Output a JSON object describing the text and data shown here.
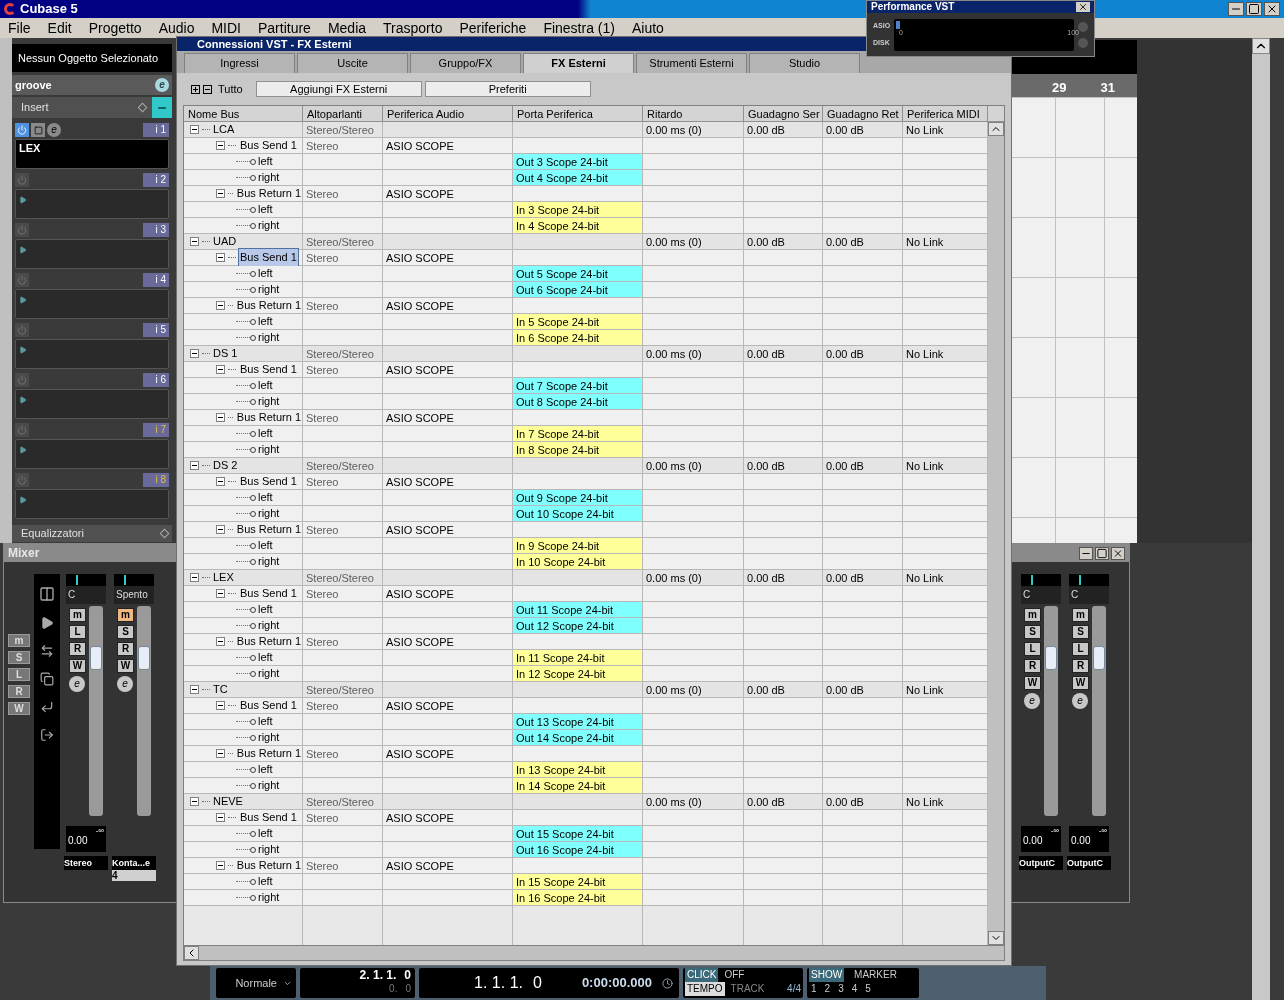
{
  "app_window": {
    "title": "Cubase 5"
  },
  "menu": [
    {
      "label": "File"
    },
    {
      "label": "Edit"
    },
    {
      "label": "Progetto"
    },
    {
      "label": "Audio"
    },
    {
      "label": "MIDI"
    },
    {
      "label": "Partiture"
    },
    {
      "label": "Media"
    },
    {
      "label": "Trasporto"
    },
    {
      "label": "Periferiche"
    },
    {
      "label": "Finestra (1)"
    },
    {
      "label": "Aiuto"
    }
  ],
  "inspector": {
    "selection": "Nessun Oggetto Selezionato",
    "track": "groove",
    "edit_button": "e",
    "insert_section": "Insert",
    "inserts": [
      {
        "slot": "i 1",
        "name": "LEX",
        "on": true,
        "post_fader": false,
        "edit": "e"
      },
      {
        "slot": "i 2",
        "on": false,
        "post_fader": false
      },
      {
        "slot": "i 3",
        "on": false,
        "post_fader": false
      },
      {
        "slot": "i 4",
        "on": false,
        "post_fader": false
      },
      {
        "slot": "i 5",
        "on": false,
        "post_fader": false
      },
      {
        "slot": "i 6",
        "on": false,
        "post_fader": false
      },
      {
        "slot": "i 7",
        "on": false,
        "post_fader": true
      },
      {
        "slot": "i 8",
        "on": false,
        "post_fader": true
      }
    ],
    "eq_section": "Equalizzatori"
  },
  "project": {
    "ruler": [
      "29",
      "31"
    ]
  },
  "mixer": {
    "title": "Mixer",
    "global_buttons": [
      "m",
      "S",
      "L",
      "R",
      "W"
    ],
    "left_channels": [
      {
        "name": "Stereo",
        "edit": "e",
        "pan": "C",
        "volume": "0.00",
        "peak": "-∞",
        "buttons": [
          {
            "label": "m",
            "on": false
          },
          {
            "label": "L",
            "on": false
          },
          {
            "label": "R",
            "on": false
          },
          {
            "label": "W",
            "on": false
          }
        ]
      },
      {
        "name": "Konta...e",
        "edit": "e",
        "pan": "Spento",
        "number": "4",
        "buttons": [
          {
            "label": "m",
            "on": true
          },
          {
            "label": "S",
            "on": false
          },
          {
            "label": "R",
            "on": false
          },
          {
            "label": "W",
            "on": false
          }
        ]
      }
    ],
    "right_channels": [
      {
        "name": "OutputC",
        "edit": "e",
        "pan": "C",
        "volume": "0.00",
        "peak": "-∞",
        "buttons": [
          {
            "label": "m",
            "on": false
          },
          {
            "label": "S",
            "on": false
          },
          {
            "label": "L",
            "on": false
          },
          {
            "label": "R",
            "on": false
          },
          {
            "label": "W",
            "on": false
          }
        ]
      },
      {
        "name": "OutputC",
        "edit": "e",
        "pan": "C",
        "volume": "0.00",
        "peak": "-∞",
        "buttons": [
          {
            "label": "m",
            "on": false
          },
          {
            "label": "S",
            "on": false
          },
          {
            "label": "L",
            "on": false
          },
          {
            "label": "R",
            "on": false
          },
          {
            "label": "W",
            "on": false
          }
        ]
      }
    ]
  },
  "dialog": {
    "title": "Connessioni VST - FX Esterni",
    "tabs": [
      {
        "label": "Ingressi",
        "selected": false
      },
      {
        "label": "Uscite",
        "selected": false
      },
      {
        "label": "Gruppo/FX",
        "selected": false
      },
      {
        "label": "FX Esterni",
        "selected": true
      },
      {
        "label": "Strumenti Esterni",
        "selected": false
      },
      {
        "label": "Studio",
        "selected": false
      }
    ],
    "all_label": "Tutto",
    "buttons": [
      "Aggiungi FX Esterni",
      "Preferiti"
    ],
    "columns": [
      "Nome Bus",
      "Altoparlanti",
      "Periferica Audio",
      "Porta Periferica",
      "Ritardo",
      "Guadagno Ser",
      "Guadagno Ret",
      "Periferica MIDI"
    ],
    "buses": [
      {
        "name": "LCA",
        "speakers": "Stereo/Stereo",
        "delay": "0.00 ms (0)",
        "send_gain": "0.00 dB",
        "return_gain": "0.00 dB",
        "midi": "No Link",
        "expanded": true,
        "children": [
          {
            "name": "Bus Send 1",
            "kind": "send",
            "speakers": "Stereo",
            "device": "ASIO SCOPE",
            "expanded": true,
            "selected": false,
            "children": [
              {
                "name": "left",
                "port": "Out 3 Scope 24-bit"
              },
              {
                "name": "right",
                "port": "Out 4 Scope 24-bit"
              }
            ]
          },
          {
            "name": "Bus Return 1",
            "kind": "return",
            "speakers": "Stereo",
            "device": "ASIO SCOPE",
            "expanded": true,
            "selected": false,
            "children": [
              {
                "name": "left",
                "port": "In 3 Scope 24-bit"
              },
              {
                "name": "right",
                "port": "In 4 Scope 24-bit"
              }
            ]
          }
        ]
      },
      {
        "name": "UAD",
        "speakers": "Stereo/Stereo",
        "delay": "0.00 ms (0)",
        "send_gain": "0.00 dB",
        "return_gain": "0.00 dB",
        "midi": "No Link",
        "expanded": true,
        "children": [
          {
            "name": "Bus Send 1",
            "kind": "send",
            "speakers": "Stereo",
            "device": "ASIO SCOPE",
            "expanded": true,
            "selected": true,
            "children": [
              {
                "name": "left",
                "port": "Out 5 Scope 24-bit"
              },
              {
                "name": "right",
                "port": "Out 6 Scope 24-bit"
              }
            ]
          },
          {
            "name": "Bus Return 1",
            "kind": "return",
            "speakers": "Stereo",
            "device": "ASIO SCOPE",
            "expanded": true,
            "selected": false,
            "children": [
              {
                "name": "left",
                "port": "In 5 Scope 24-bit"
              },
              {
                "name": "right",
                "port": "In 6 Scope 24-bit"
              }
            ]
          }
        ]
      },
      {
        "name": "DS 1",
        "speakers": "Stereo/Stereo",
        "delay": "0.00 ms (0)",
        "send_gain": "0.00 dB",
        "return_gain": "0.00 dB",
        "midi": "No Link",
        "expanded": true,
        "children": [
          {
            "name": "Bus Send 1",
            "kind": "send",
            "speakers": "Stereo",
            "device": "ASIO SCOPE",
            "expanded": true,
            "selected": false,
            "children": [
              {
                "name": "left",
                "port": "Out 7 Scope 24-bit"
              },
              {
                "name": "right",
                "port": "Out 8 Scope 24-bit"
              }
            ]
          },
          {
            "name": "Bus Return 1",
            "kind": "return",
            "speakers": "Stereo",
            "device": "ASIO SCOPE",
            "expanded": true,
            "selected": false,
            "children": [
              {
                "name": "left",
                "port": "In 7 Scope 24-bit"
              },
              {
                "name": "right",
                "port": "In 8 Scope 24-bit"
              }
            ]
          }
        ]
      },
      {
        "name": "DS 2",
        "speakers": "Stereo/Stereo",
        "delay": "0.00 ms (0)",
        "send_gain": "0.00 dB",
        "return_gain": "0.00 dB",
        "midi": "No Link",
        "expanded": true,
        "children": [
          {
            "name": "Bus Send 1",
            "kind": "send",
            "speakers": "Stereo",
            "device": "ASIO SCOPE",
            "expanded": true,
            "selected": false,
            "children": [
              {
                "name": "left",
                "port": "Out 9 Scope 24-bit"
              },
              {
                "name": "right",
                "port": "Out 10 Scope 24-bit"
              }
            ]
          },
          {
            "name": "Bus Return 1",
            "kind": "return",
            "speakers": "Stereo",
            "device": "ASIO SCOPE",
            "expanded": true,
            "selected": false,
            "children": [
              {
                "name": "left",
                "port": "In 9 Scope 24-bit"
              },
              {
                "name": "right",
                "port": "In 10 Scope 24-bit"
              }
            ]
          }
        ]
      },
      {
        "name": "LEX",
        "speakers": "Stereo/Stereo",
        "delay": "0.00 ms (0)",
        "send_gain": "0.00 dB",
        "return_gain": "0.00 dB",
        "midi": "No Link",
        "expanded": true,
        "children": [
          {
            "name": "Bus Send 1",
            "kind": "send",
            "speakers": "Stereo",
            "device": "ASIO SCOPE",
            "expanded": true,
            "selected": false,
            "children": [
              {
                "name": "left",
                "port": "Out 11 Scope 24-bit"
              },
              {
                "name": "right",
                "port": "Out 12 Scope 24-bit"
              }
            ]
          },
          {
            "name": "Bus Return 1",
            "kind": "return",
            "speakers": "Stereo",
            "device": "ASIO SCOPE",
            "expanded": true,
            "selected": false,
            "children": [
              {
                "name": "left",
                "port": "In 11 Scope 24-bit"
              },
              {
                "name": "right",
                "port": "In 12 Scope 24-bit"
              }
            ]
          }
        ]
      },
      {
        "name": "TC",
        "speakers": "Stereo/Stereo",
        "delay": "0.00 ms (0)",
        "send_gain": "0.00 dB",
        "return_gain": "0.00 dB",
        "midi": "No Link",
        "expanded": true,
        "children": [
          {
            "name": "Bus Send 1",
            "kind": "send",
            "speakers": "Stereo",
            "device": "ASIO SCOPE",
            "expanded": true,
            "selected": false,
            "children": [
              {
                "name": "left",
                "port": "Out 13 Scope 24-bit"
              },
              {
                "name": "right",
                "port": "Out 14 Scope 24-bit"
              }
            ]
          },
          {
            "name": "Bus Return 1",
            "kind": "return",
            "speakers": "Stereo",
            "device": "ASIO SCOPE",
            "expanded": true,
            "selected": false,
            "children": [
              {
                "name": "left",
                "port": "In 13 Scope 24-bit"
              },
              {
                "name": "right",
                "port": "In 14 Scope 24-bit"
              }
            ]
          }
        ]
      },
      {
        "name": "NEVE",
        "speakers": "Stereo/Stereo",
        "delay": "0.00 ms (0)",
        "send_gain": "0.00 dB",
        "return_gain": "0.00 dB",
        "midi": "No Link",
        "expanded": true,
        "children": [
          {
            "name": "Bus Send 1",
            "kind": "send",
            "speakers": "Stereo",
            "device": "ASIO SCOPE",
            "expanded": true,
            "selected": false,
            "children": [
              {
                "name": "left",
                "port": "Out 15 Scope 24-bit"
              },
              {
                "name": "right",
                "port": "Out 16 Scope 24-bit"
              }
            ]
          },
          {
            "name": "Bus Return 1",
            "kind": "return",
            "speakers": "Stereo",
            "device": "ASIO SCOPE",
            "expanded": true,
            "selected": false,
            "children": [
              {
                "name": "left",
                "port": "In 15 Scope 24-bit"
              },
              {
                "name": "right",
                "port": "In 16 Scope 24-bit"
              }
            ]
          }
        ]
      }
    ]
  },
  "performance": {
    "title": "Performance VST",
    "meters": [
      {
        "label": "ASIO",
        "level": 0.02
      },
      {
        "label": "DISK"
      }
    ],
    "scale": [
      "0",
      "100"
    ]
  },
  "transport": {
    "mode": "Normale",
    "left_locator": "2. 1. 1.",
    "left_ticks": "0",
    "left_sub": "0.",
    "left_sub_ticks": "0",
    "position": "1. 1. 1.",
    "position_ticks": "0",
    "time": "0:00:00.000",
    "click": "CLICK",
    "click_state": "OFF",
    "tempo": "TEMPO",
    "tempo_state": "TRACK",
    "signature": "4/4",
    "show": "SHOW",
    "marker": "MARKER",
    "markers": [
      "1",
      "2",
      "3",
      "4",
      "5"
    ]
  }
}
